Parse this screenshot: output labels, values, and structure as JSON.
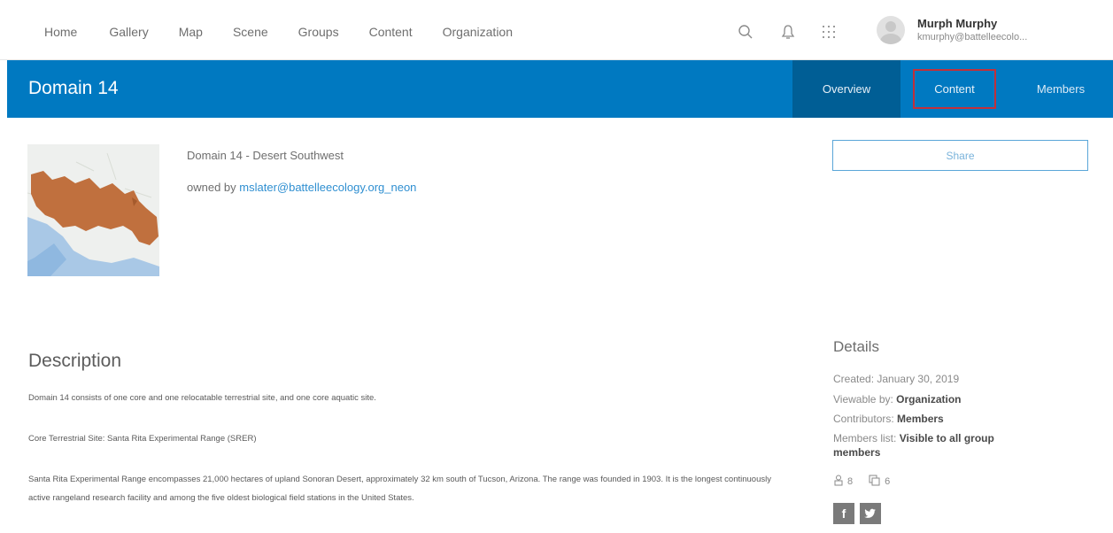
{
  "nav": {
    "links": [
      "Home",
      "Gallery",
      "Map",
      "Scene",
      "Groups",
      "Content",
      "Organization"
    ],
    "user_name": "Murph Murphy",
    "user_email": "kmurphy@battelleecolo..."
  },
  "group": {
    "title": "Domain 14",
    "tabs": {
      "overview": "Overview",
      "content": "Content",
      "members": "Members"
    },
    "full_title": "Domain 14 - Desert Southwest",
    "owned_by_label": "owned by",
    "owner": "mslater@battelleecology.org_neon",
    "share_label": "Share"
  },
  "description": {
    "heading": "Description",
    "paragraphs": [
      "Domain 14 consists of one core and one relocatable terrestrial site, and one core aquatic site.",
      "Core Terrestrial Site: Santa Rita Experimental Range (SRER)",
      "Santa Rita Experimental Range encompasses 21,000 hectares of upland Sonoran Desert, approximately 32 km south of Tucson, Arizona. The range was founded in 1903. It is the longest continuously active rangeland research facility and among the five oldest biological field stations in the United States."
    ]
  },
  "details": {
    "heading": "Details",
    "created_label": "Created:",
    "created_value": "January 30, 2019",
    "viewable_label": "Viewable by:",
    "viewable_value": "Organization",
    "contributors_label": "Contributors:",
    "contributors_value": "Members",
    "members_list_label": "Members list:",
    "members_list_value": "Visible to all group members",
    "member_count": "8",
    "item_count": "6"
  },
  "colors": {
    "header_blue": "#0079c1",
    "active_tab": "#005e95",
    "highlight_red": "#c2303a",
    "link_blue": "#2f8fd1",
    "region_orange": "#c0703e"
  }
}
